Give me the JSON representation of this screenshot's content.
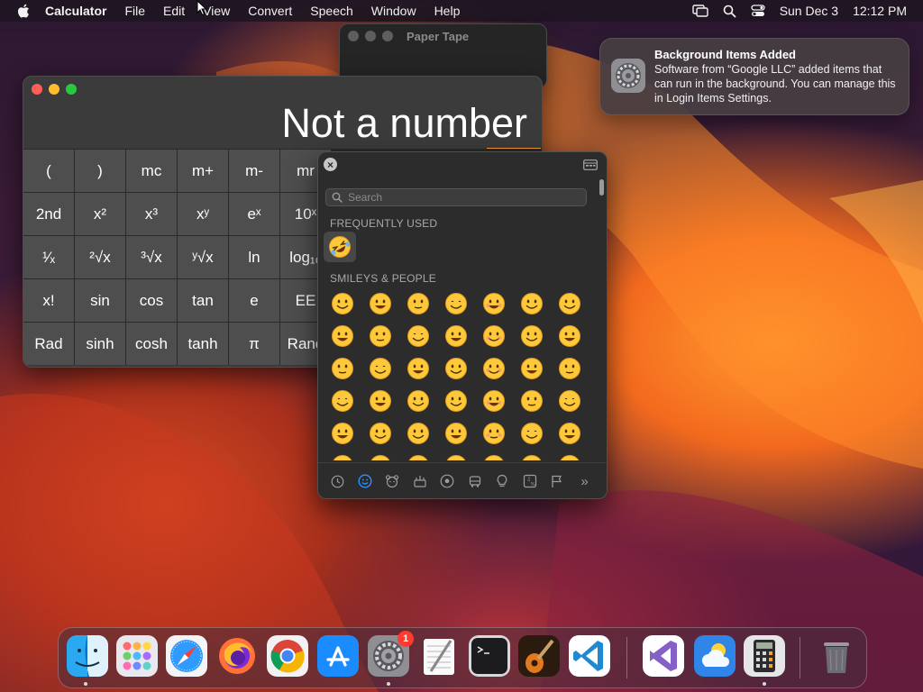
{
  "menubar": {
    "app_name": "Calculator",
    "items": [
      "File",
      "Edit",
      "View",
      "Convert",
      "Speech",
      "Window",
      "Help"
    ],
    "clock": {
      "date": "Sun Dec 3",
      "time": "12:12 PM"
    }
  },
  "paper_tape": {
    "title": "Paper Tape"
  },
  "calculator": {
    "display": "Not a number",
    "keys": [
      [
        "(",
        ")",
        "mc",
        "m+",
        "m-",
        "mr"
      ],
      [
        "2nd",
        "x²",
        "x³",
        "xʸ",
        "eˣ",
        "10ˣ"
      ],
      [
        "¹⁄ₓ",
        "²√x",
        "³√x",
        "ʸ√x",
        "ln",
        "log₁₀"
      ],
      [
        "x!",
        "sin",
        "cos",
        "tan",
        "e",
        "EE"
      ],
      [
        "Rad",
        "sinh",
        "cosh",
        "tanh",
        "π",
        "Rand"
      ]
    ]
  },
  "emoji_picker": {
    "search_placeholder": "Search",
    "frequently_used_label": "FREQUENTLY USED",
    "smileys_label": "SMILEYS & PEOPLE",
    "frequently_used": [
      "🤣"
    ],
    "smileys": [
      "😀",
      "😃",
      "😄",
      "😁",
      "😆",
      "🥹",
      "😅",
      "😂",
      "🤣",
      "🥲",
      "☺️",
      "😊",
      "😇",
      "🙂",
      "🙃",
      "😉",
      "😌",
      "😍",
      "🥰",
      "😘",
      "😗",
      "😙",
      "😚",
      "😋",
      "😛",
      "😝",
      "😜",
      "🤪",
      "🤨",
      "🧐",
      "🤓",
      "😎",
      "🥸",
      "🤩",
      "🥳",
      "😏",
      "😒",
      "😞",
      "😔",
      "😟",
      "😕",
      "🙁"
    ],
    "category_tabs": [
      "clock-icon",
      "smiley-icon",
      "animal-icon",
      "food-icon",
      "activity-icon",
      "travel-icon",
      "objects-icon",
      "symbols-icon",
      "flags-icon"
    ],
    "more_label": "»"
  },
  "notification": {
    "title": "Background Items Added",
    "body": "Software from “Google LLC” added items that can run in the background. You can manage this in Login Items Settings."
  },
  "dock": {
    "apps": [
      "Finder",
      "Launchpad",
      "Safari",
      "Firefox",
      "Google Chrome",
      "App Store",
      "System Settings",
      "TextEdit",
      "Terminal",
      "GarageBand",
      "Visual Studio Code",
      "Visual Studio",
      "Weather",
      "Calculator",
      "Trash"
    ],
    "settings_badge": "1"
  },
  "colors": {
    "accent_orange": "#f5a030",
    "close_red": "#ff5f57",
    "minimize_yellow": "#febc2e",
    "zoom_green": "#28c840",
    "badge_red": "#ff3b30"
  }
}
